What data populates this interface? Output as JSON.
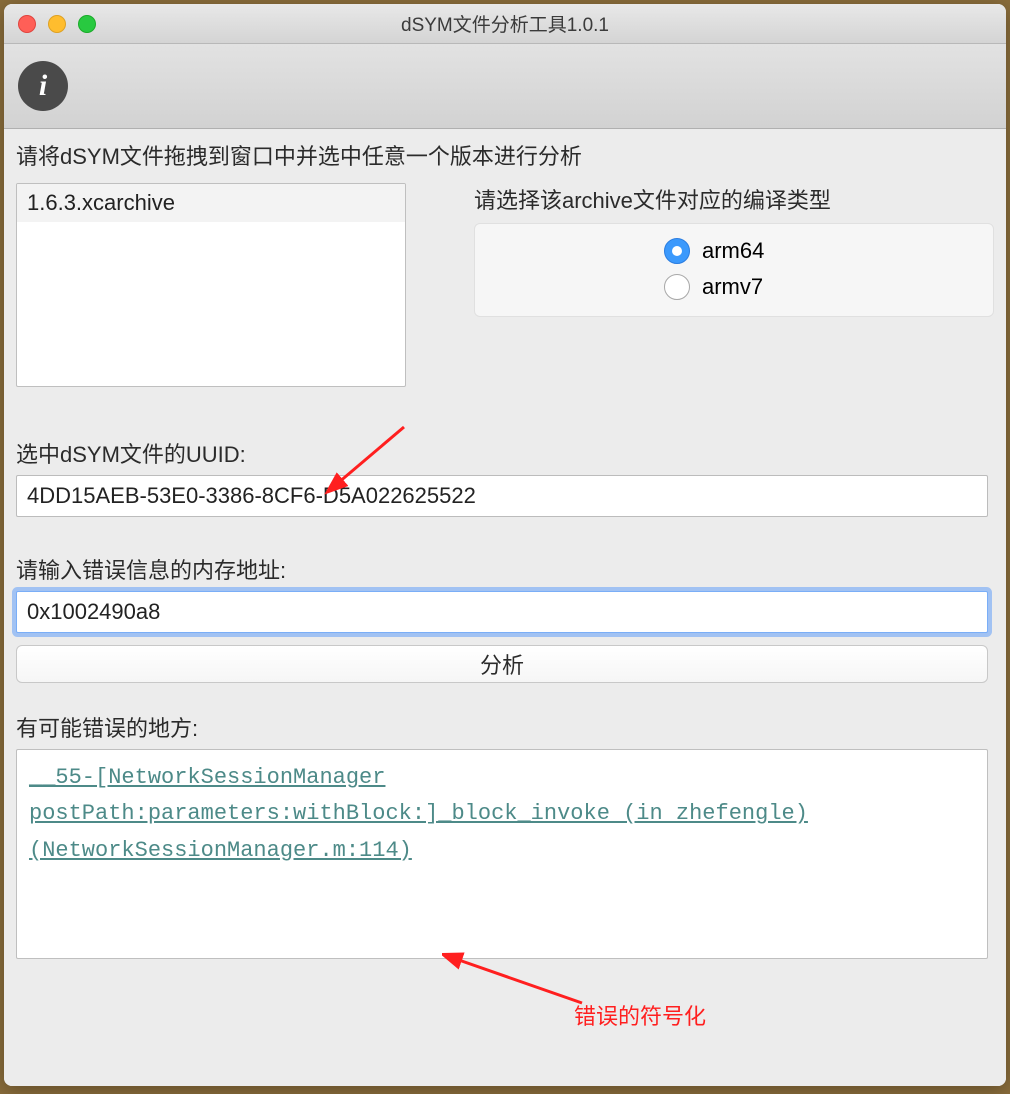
{
  "window": {
    "title": "dSYM文件分析工具1.0.1"
  },
  "toolbar": {
    "info_icon": "i"
  },
  "instructions": {
    "drag": "请将dSYM文件拖拽到窗口中并选中任意一个版本进行分析"
  },
  "file_list": {
    "items": [
      "1.6.3.xcarchive"
    ]
  },
  "arch": {
    "label": "请选择该archive文件对应的编译类型",
    "options": [
      {
        "label": "arm64",
        "checked": true
      },
      {
        "label": "armv7",
        "checked": false
      }
    ]
  },
  "uuid": {
    "label": "选中dSYM文件的UUID:",
    "value": "4DD15AEB-53E0-3386-8CF6-D5A022625522"
  },
  "address": {
    "label": "请输入错误信息的内存地址:",
    "value": "0x1002490a8"
  },
  "analyze_label": "分析",
  "result": {
    "label": "有可能错误的地方:",
    "text": "__55-[NetworkSessionManager postPath:parameters:withBlock:]_block_invoke (in zhefengle) (NetworkSessionManager.m:114)"
  },
  "annotation": {
    "text": "错误的符号化"
  }
}
